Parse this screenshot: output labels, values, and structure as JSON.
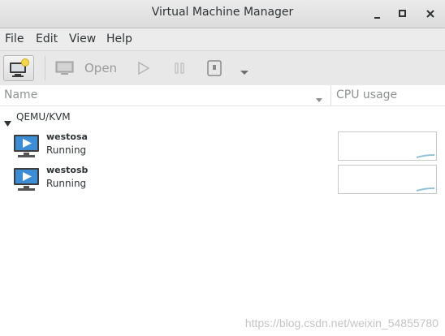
{
  "window": {
    "title": "Virtual Machine Manager"
  },
  "menu": [
    {
      "label": "File"
    },
    {
      "label": "Edit"
    },
    {
      "label": "View"
    },
    {
      "label": "Help"
    }
  ],
  "toolbar": {
    "open_label": "Open"
  },
  "columns": {
    "name": "Name",
    "cpu": "CPU usage"
  },
  "connection": {
    "label": "QEMU/KVM"
  },
  "vms": [
    {
      "name": "westosa",
      "status": "Running"
    },
    {
      "name": "westosb",
      "status": "Running"
    }
  ],
  "watermark": "https://blog.csdn.net/weixin_54855780"
}
